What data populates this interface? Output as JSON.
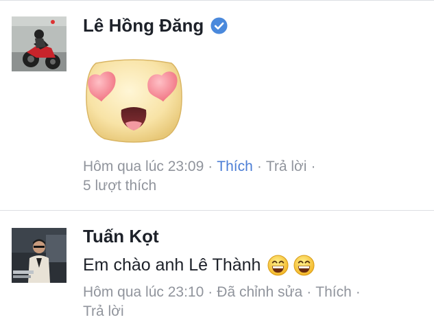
{
  "comments": [
    {
      "author": "Lê Hồng Đăng",
      "verified": true,
      "sticker": "heart-eyes-sticker",
      "meta": {
        "time": "Hôm qua lúc 23:09",
        "like_label": "Thích",
        "reply_label": "Trả lời",
        "likes": "5 lượt thích"
      }
    },
    {
      "author": "Tuấn Kọt",
      "text": "Em chào anh Lê Thành",
      "emojis": [
        "grinning-emoji",
        "grinning-emoji"
      ],
      "meta": {
        "time": "Hôm qua lúc 23:10",
        "edited": "Đã chỉnh sửa",
        "like_label": "Thích",
        "reply_label": "Trả lời"
      }
    }
  ],
  "colors": {
    "link": "#4b7dd5",
    "meta": "#90949c",
    "verified": "#4a89dc",
    "divider": "#dcdee3"
  }
}
